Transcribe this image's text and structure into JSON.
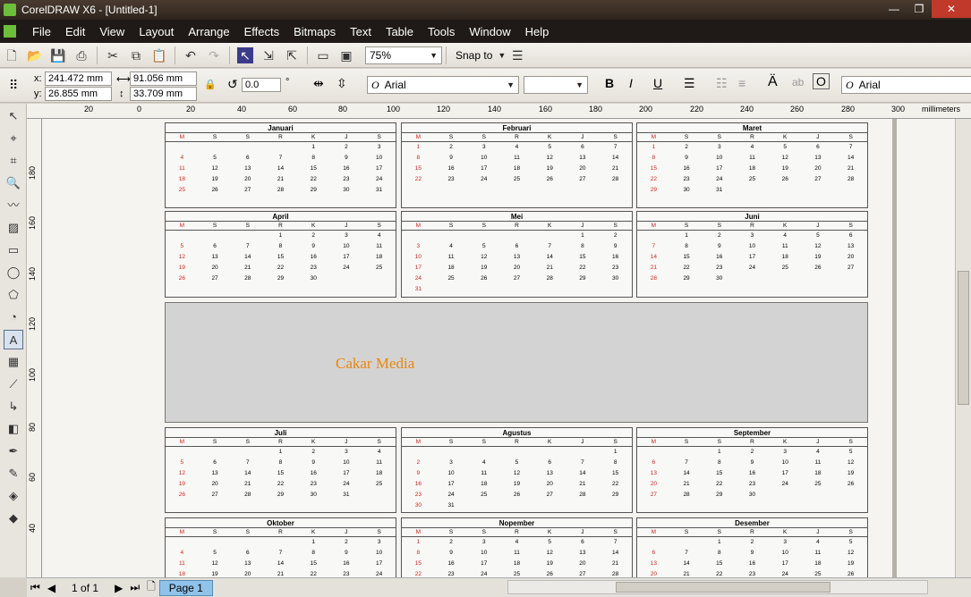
{
  "window": {
    "title": "CorelDRAW X6 - [Untitled-1]",
    "controls": [
      "—",
      "❐",
      "✕"
    ]
  },
  "menu": [
    "File",
    "Edit",
    "View",
    "Layout",
    "Arrange",
    "Effects",
    "Bitmaps",
    "Text",
    "Table",
    "Tools",
    "Window",
    "Help"
  ],
  "toolbar": {
    "zoom": "75%",
    "snap_label": "Snap to"
  },
  "property_bar": {
    "x_label": "x:",
    "x_value": "241.472 mm",
    "y_label": "y:",
    "y_value": "26.855 mm",
    "w_value": "91.056 mm",
    "h_value": "33.709 mm",
    "rotation": "0.0",
    "degree": "°",
    "font": "Arial",
    "font_right": "Arial"
  },
  "rulers": {
    "unit": "millimeters",
    "h_ticks": [
      "20",
      "0",
      "20",
      "40",
      "60",
      "80",
      "100",
      "120",
      "140",
      "160",
      "180",
      "200",
      "220",
      "240",
      "260",
      "280",
      "300"
    ],
    "v_ticks": [
      "180",
      "160",
      "140",
      "120",
      "100",
      "80",
      "60",
      "40"
    ]
  },
  "day_headers": [
    "M",
    "S",
    "S",
    "R",
    "K",
    "J",
    "S"
  ],
  "months": [
    {
      "name": "Januari",
      "rows": [
        [
          "",
          "",
          "",
          "",
          "1",
          "2",
          "3"
        ],
        [
          "4",
          "5",
          "6",
          "7",
          "8",
          "9",
          "10"
        ],
        [
          "11",
          "12",
          "13",
          "14",
          "15",
          "16",
          "17"
        ],
        [
          "18",
          "19",
          "20",
          "21",
          "22",
          "23",
          "24"
        ],
        [
          "25",
          "26",
          "27",
          "28",
          "29",
          "30",
          "31"
        ]
      ]
    },
    {
      "name": "Februari",
      "rows": [
        [
          "1",
          "2",
          "3",
          "4",
          "5",
          "6",
          "7"
        ],
        [
          "8",
          "9",
          "10",
          "11",
          "12",
          "13",
          "14"
        ],
        [
          "15",
          "16",
          "17",
          "18",
          "19",
          "20",
          "21"
        ],
        [
          "22",
          "23",
          "24",
          "25",
          "26",
          "27",
          "28"
        ]
      ]
    },
    {
      "name": "Maret",
      "rows": [
        [
          "1",
          "2",
          "3",
          "4",
          "5",
          "6",
          "7"
        ],
        [
          "8",
          "9",
          "10",
          "11",
          "12",
          "13",
          "14"
        ],
        [
          "15",
          "16",
          "17",
          "18",
          "19",
          "20",
          "21"
        ],
        [
          "22",
          "23",
          "24",
          "25",
          "26",
          "27",
          "28"
        ],
        [
          "29",
          "30",
          "31",
          "",
          "",
          "",
          ""
        ]
      ]
    },
    {
      "name": "April",
      "rows": [
        [
          "",
          "",
          "",
          "1",
          "2",
          "3",
          "4"
        ],
        [
          "5",
          "6",
          "7",
          "8",
          "9",
          "10",
          "11"
        ],
        [
          "12",
          "13",
          "14",
          "15",
          "16",
          "17",
          "18"
        ],
        [
          "19",
          "20",
          "21",
          "22",
          "23",
          "24",
          "25"
        ],
        [
          "26",
          "27",
          "28",
          "29",
          "30",
          "",
          ""
        ]
      ]
    },
    {
      "name": "Mei",
      "rows": [
        [
          "",
          "",
          "",
          "",
          "",
          "1",
          "2"
        ],
        [
          "3",
          "4",
          "5",
          "6",
          "7",
          "8",
          "9"
        ],
        [
          "10",
          "11",
          "12",
          "13",
          "14",
          "15",
          "16"
        ],
        [
          "17",
          "18",
          "19",
          "20",
          "21",
          "22",
          "23"
        ],
        [
          "24",
          "25",
          "26",
          "27",
          "28",
          "29",
          "30"
        ],
        [
          "31",
          "",
          "",
          "",
          "",
          "",
          ""
        ]
      ]
    },
    {
      "name": "Juni",
      "rows": [
        [
          "",
          "1",
          "2",
          "3",
          "4",
          "5",
          "6"
        ],
        [
          "7",
          "8",
          "9",
          "10",
          "11",
          "12",
          "13"
        ],
        [
          "14",
          "15",
          "16",
          "17",
          "18",
          "19",
          "20"
        ],
        [
          "21",
          "22",
          "23",
          "24",
          "25",
          "26",
          "27"
        ],
        [
          "28",
          "29",
          "30",
          "",
          "",
          "",
          ""
        ]
      ]
    },
    {
      "name": "Juli",
      "rows": [
        [
          "",
          "",
          "",
          "1",
          "2",
          "3",
          "4"
        ],
        [
          "5",
          "6",
          "7",
          "8",
          "9",
          "10",
          "11"
        ],
        [
          "12",
          "13",
          "14",
          "15",
          "16",
          "17",
          "18"
        ],
        [
          "19",
          "20",
          "21",
          "22",
          "23",
          "24",
          "25"
        ],
        [
          "26",
          "27",
          "28",
          "29",
          "30",
          "31",
          ""
        ]
      ]
    },
    {
      "name": "Agustus",
      "rows": [
        [
          "",
          "",
          "",
          "",
          "",
          "",
          "1"
        ],
        [
          "2",
          "3",
          "4",
          "5",
          "6",
          "7",
          "8"
        ],
        [
          "9",
          "10",
          "11",
          "12",
          "13",
          "14",
          "15"
        ],
        [
          "16",
          "17",
          "18",
          "19",
          "20",
          "21",
          "22"
        ],
        [
          "23",
          "24",
          "25",
          "26",
          "27",
          "28",
          "29"
        ],
        [
          "30",
          "31",
          "",
          "",
          "",
          "",
          ""
        ]
      ]
    },
    {
      "name": "September",
      "rows": [
        [
          "",
          "",
          "1",
          "2",
          "3",
          "4",
          "5"
        ],
        [
          "6",
          "7",
          "8",
          "9",
          "10",
          "11",
          "12"
        ],
        [
          "13",
          "14",
          "15",
          "16",
          "17",
          "18",
          "19"
        ],
        [
          "20",
          "21",
          "22",
          "23",
          "24",
          "25",
          "26"
        ],
        [
          "27",
          "28",
          "29",
          "30",
          "",
          "",
          ""
        ]
      ]
    },
    {
      "name": "Oktober",
      "rows": [
        [
          "",
          "",
          "",
          "",
          "1",
          "2",
          "3"
        ],
        [
          "4",
          "5",
          "6",
          "7",
          "8",
          "9",
          "10"
        ],
        [
          "11",
          "12",
          "13",
          "14",
          "15",
          "16",
          "17"
        ],
        [
          "18",
          "19",
          "20",
          "21",
          "22",
          "23",
          "24"
        ]
      ]
    },
    {
      "name": "Nopember",
      "rows": [
        [
          "1",
          "2",
          "3",
          "4",
          "5",
          "6",
          "7"
        ],
        [
          "8",
          "9",
          "10",
          "11",
          "12",
          "13",
          "14"
        ],
        [
          "15",
          "16",
          "17",
          "18",
          "19",
          "20",
          "21"
        ],
        [
          "22",
          "23",
          "24",
          "25",
          "26",
          "27",
          "28"
        ]
      ]
    },
    {
      "name": "Desember",
      "rows": [
        [
          "",
          "",
          "1",
          "2",
          "3",
          "4",
          "5"
        ],
        [
          "6",
          "7",
          "8",
          "9",
          "10",
          "11",
          "12"
        ],
        [
          "13",
          "14",
          "15",
          "16",
          "17",
          "18",
          "19"
        ],
        [
          "20",
          "21",
          "22",
          "23",
          "24",
          "25",
          "26"
        ]
      ]
    }
  ],
  "banner": {
    "text": "Cakar Media"
  },
  "pagebar": {
    "page_count": "1 of 1",
    "page_tab": "Page 1"
  },
  "colors": {
    "sunday": "#d0261d",
    "banner_text": "#e8860f",
    "banner_bg": "#d3d3d3"
  }
}
